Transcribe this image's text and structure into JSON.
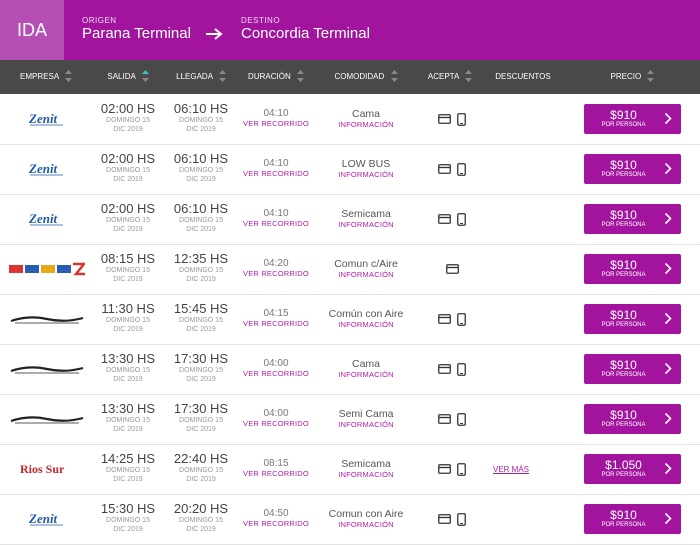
{
  "route": {
    "tab": "IDA",
    "origin_label": "ORIGEN",
    "origin": "Parana Terminal",
    "dest_label": "DESTINO",
    "dest": "Concordia Terminal"
  },
  "columns": {
    "empresa": "EMPRESA",
    "salida": "SALIDA",
    "llegada": "LLEGADA",
    "duracion": "DURACIÓN",
    "comodidad": "COMODIDAD",
    "acepta": "ACEPTA",
    "descuentos": "DESCUENTOS",
    "precio": "PRECIO"
  },
  "labels": {
    "ver_recorrido": "VER RECORRIDO",
    "informacion": "INFORMACIÓN",
    "por_persona": "POR PERSONA",
    "ver_mas": "VER MÁS"
  },
  "colors": {
    "brand": "#a3149e",
    "header_bg": "#494949",
    "link": "#b01da9"
  },
  "rows": [
    {
      "company": "Zenit",
      "salida": "02:00 HS",
      "salida_day": "DOMINGO 15",
      "salida_month": "DIC 2019",
      "llegada": "06:10 HS",
      "llegada_day": "DOMINGO 15",
      "llegada_month": "DIC 2019",
      "duration": "04:10",
      "comfort": "Cama",
      "accepts": [
        "card-icon",
        "phone-icon"
      ],
      "discount": "",
      "price": "$910"
    },
    {
      "company": "Zenit",
      "salida": "02:00 HS",
      "salida_day": "DOMINGO 15",
      "salida_month": "DIC 2019",
      "llegada": "06:10 HS",
      "llegada_day": "DOMINGO 15",
      "llegada_month": "DIC 2019",
      "duration": "04:10",
      "comfort": "LOW BUS",
      "accepts": [
        "card-icon",
        "phone-icon"
      ],
      "discount": "",
      "price": "$910"
    },
    {
      "company": "Zenit",
      "salida": "02:00 HS",
      "salida_day": "DOMINGO 15",
      "salida_month": "DIC 2019",
      "llegada": "06:10 HS",
      "llegada_day": "DOMINGO 15",
      "llegada_month": "DIC 2019",
      "duration": "04:10",
      "comfort": "Semicama",
      "accepts": [
        "card-icon",
        "phone-icon"
      ],
      "discount": "",
      "price": "$910"
    },
    {
      "company": "Multi",
      "salida": "08:15 HS",
      "salida_day": "DOMINGO 15",
      "salida_month": "DIC 2019",
      "llegada": "12:35 HS",
      "llegada_day": "DOMINGO 15",
      "llegada_month": "DIC 2019",
      "duration": "04:20",
      "comfort": "Comun c/Aire",
      "accepts": [
        "card-icon"
      ],
      "discount": "",
      "price": "$910"
    },
    {
      "company": "Rapido Tata",
      "salida": "11:30 HS",
      "salida_day": "DOMINGO 15",
      "salida_month": "DIC 2019",
      "llegada": "15:45 HS",
      "llegada_day": "DOMINGO 15",
      "llegada_month": "DIC 2019",
      "duration": "04:15",
      "comfort": "Común con Aire",
      "accepts": [
        "card-icon",
        "phone-icon"
      ],
      "discount": "",
      "price": "$910"
    },
    {
      "company": "Rapido Tata",
      "salida": "13:30 HS",
      "salida_day": "DOMINGO 15",
      "salida_month": "DIC 2019",
      "llegada": "17:30 HS",
      "llegada_day": "DOMINGO 15",
      "llegada_month": "DIC 2019",
      "duration": "04:00",
      "comfort": "Cama",
      "accepts": [
        "card-icon",
        "phone-icon"
      ],
      "discount": "",
      "price": "$910"
    },
    {
      "company": "Rapido Tata",
      "salida": "13:30 HS",
      "salida_day": "DOMINGO 15",
      "salida_month": "DIC 2019",
      "llegada": "17:30 HS",
      "llegada_day": "DOMINGO 15",
      "llegada_month": "DIC 2019",
      "duration": "04:00",
      "comfort": "Semi Cama",
      "accepts": [
        "card-icon",
        "phone-icon"
      ],
      "discount": "",
      "price": "$910"
    },
    {
      "company": "Rios Sur",
      "salida": "14:25 HS",
      "salida_day": "DOMINGO 15",
      "salida_month": "DIC 2019",
      "llegada": "22:40 HS",
      "llegada_day": "DOMINGO 15",
      "llegada_month": "DIC 2019",
      "duration": "08:15",
      "comfort": "Semicama",
      "accepts": [
        "card-icon",
        "phone-icon"
      ],
      "discount": "VER MÁS",
      "price": "$1.050"
    },
    {
      "company": "Zenit",
      "salida": "15:30 HS",
      "salida_day": "DOMINGO 15",
      "salida_month": "DIC 2019",
      "llegada": "20:20 HS",
      "llegada_day": "DOMINGO 15",
      "llegada_month": "DIC 2019",
      "duration": "04:50",
      "comfort": "Comun con Aire",
      "accepts": [
        "card-icon",
        "phone-icon"
      ],
      "discount": "",
      "price": "$910"
    }
  ]
}
